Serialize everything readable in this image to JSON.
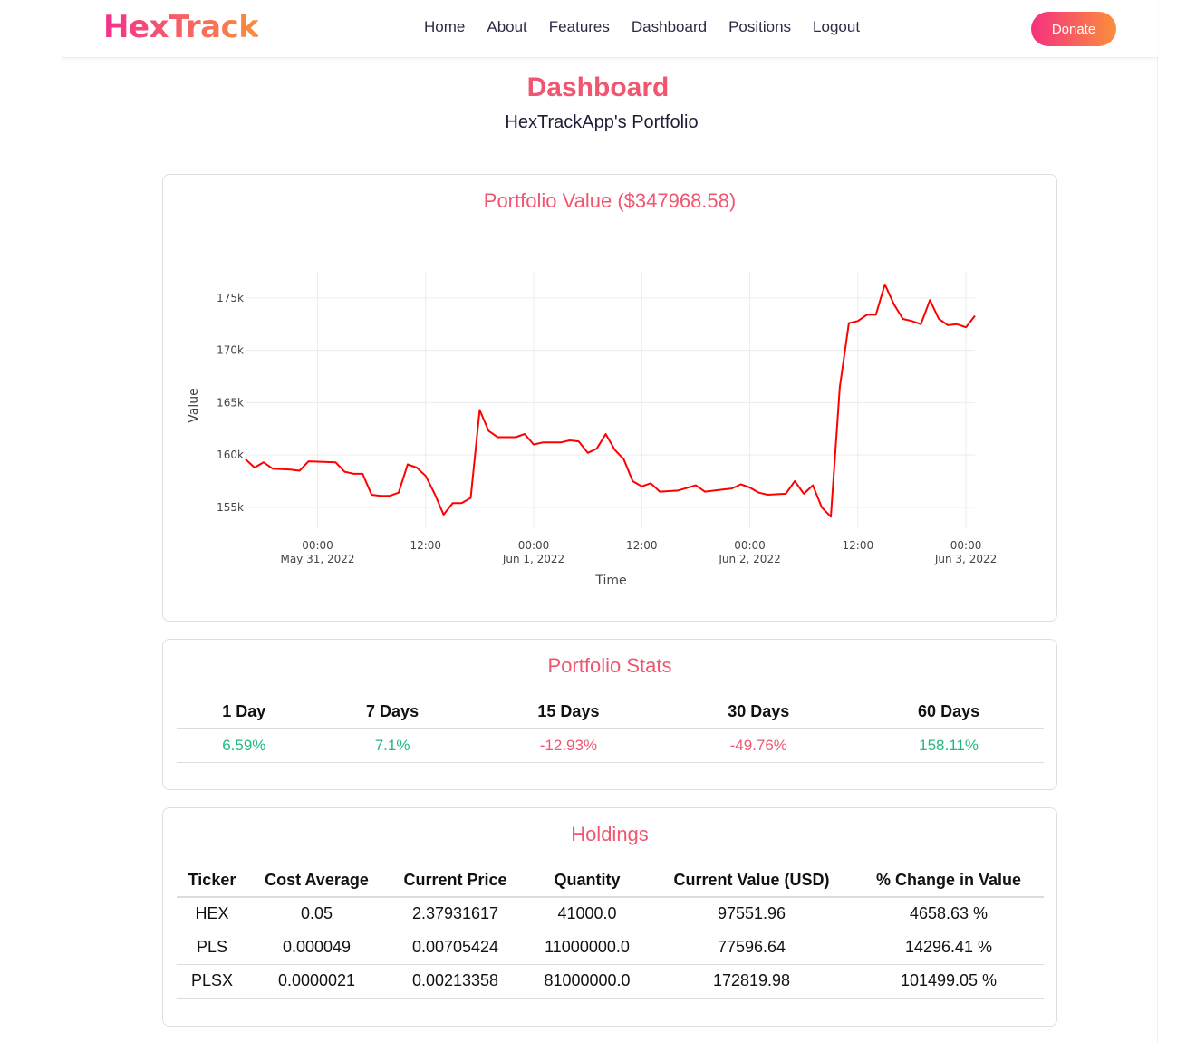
{
  "brand": {
    "name": "HexTrack"
  },
  "nav": {
    "items": [
      "Home",
      "About",
      "Features",
      "Dashboard",
      "Positions",
      "Logout"
    ],
    "donate_label": "Donate"
  },
  "header": {
    "title": "Dashboard",
    "subtitle": "HexTrackApp's Portfolio"
  },
  "chart": {
    "title": "Portfolio Value ($347968.58)"
  },
  "chart_data": {
    "type": "line",
    "xlabel": "Time",
    "ylabel": "Value",
    "line_color": "#ff0000",
    "grid": true,
    "ylim": [
      153000,
      177500
    ],
    "xlim": [
      "2022-05-30 16:00",
      "2022-06-03 01:00"
    ],
    "yticks": [
      {
        "value": 155000,
        "label": "155k"
      },
      {
        "value": 160000,
        "label": "160k"
      },
      {
        "value": 165000,
        "label": "165k"
      },
      {
        "value": 170000,
        "label": "170k"
      },
      {
        "value": 175000,
        "label": "175k"
      }
    ],
    "xticks": [
      {
        "value": "2022-05-31 00:00",
        "label": "00:00",
        "sublabel": "May 31, 2022"
      },
      {
        "value": "2022-05-31 12:00",
        "label": "12:00",
        "sublabel": ""
      },
      {
        "value": "2022-06-01 00:00",
        "label": "00:00",
        "sublabel": "Jun 1, 2022"
      },
      {
        "value": "2022-06-01 12:00",
        "label": "12:00",
        "sublabel": ""
      },
      {
        "value": "2022-06-02 00:00",
        "label": "00:00",
        "sublabel": "Jun 2, 2022"
      },
      {
        "value": "2022-06-02 12:00",
        "label": "12:00",
        "sublabel": ""
      },
      {
        "value": "2022-06-03 00:00",
        "label": "00:00",
        "sublabel": "Jun 3, 2022"
      }
    ],
    "series": [
      {
        "points": [
          [
            "2022-05-30 16:00",
            159600
          ],
          [
            "2022-05-30 17:00",
            158800
          ],
          [
            "2022-05-30 18:00",
            159300
          ],
          [
            "2022-05-30 19:00",
            158700
          ],
          [
            "2022-05-30 21:00",
            158600
          ],
          [
            "2022-05-30 22:00",
            158500
          ],
          [
            "2022-05-30 23:00",
            159400
          ],
          [
            "2022-05-31 02:00",
            159300
          ],
          [
            "2022-05-31 03:00",
            158400
          ],
          [
            "2022-05-31 04:00",
            158200
          ],
          [
            "2022-05-31 05:00",
            158200
          ],
          [
            "2022-05-31 06:00",
            156200
          ],
          [
            "2022-05-31 07:00",
            156100
          ],
          [
            "2022-05-31 08:00",
            156100
          ],
          [
            "2022-05-31 09:00",
            156400
          ],
          [
            "2022-05-31 10:00",
            159100
          ],
          [
            "2022-05-31 11:00",
            158800
          ],
          [
            "2022-05-31 12:00",
            158000
          ],
          [
            "2022-05-31 13:00",
            156300
          ],
          [
            "2022-05-31 14:00",
            154300
          ],
          [
            "2022-05-31 15:00",
            155400
          ],
          [
            "2022-05-31 16:00",
            155400
          ],
          [
            "2022-05-31 17:00",
            155900
          ],
          [
            "2022-05-31 18:00",
            164300
          ],
          [
            "2022-05-31 19:00",
            162300
          ],
          [
            "2022-05-31 20:00",
            161700
          ],
          [
            "2022-05-31 22:00",
            161700
          ],
          [
            "2022-05-31 23:00",
            162000
          ],
          [
            "2022-06-01 00:00",
            161000
          ],
          [
            "2022-06-01 01:00",
            161200
          ],
          [
            "2022-06-01 03:00",
            161200
          ],
          [
            "2022-06-01 04:00",
            161400
          ],
          [
            "2022-06-01 05:00",
            161300
          ],
          [
            "2022-06-01 06:00",
            160200
          ],
          [
            "2022-06-01 07:00",
            160600
          ],
          [
            "2022-06-01 08:00",
            162000
          ],
          [
            "2022-06-01 09:00",
            160500
          ],
          [
            "2022-06-01 10:00",
            159600
          ],
          [
            "2022-06-01 11:00",
            157500
          ],
          [
            "2022-06-01 12:00",
            157000
          ],
          [
            "2022-06-01 13:00",
            157300
          ],
          [
            "2022-06-01 14:00",
            156500
          ],
          [
            "2022-06-01 16:00",
            156600
          ],
          [
            "2022-06-01 18:00",
            157100
          ],
          [
            "2022-06-01 19:00",
            156500
          ],
          [
            "2022-06-01 21:00",
            156700
          ],
          [
            "2022-06-01 22:00",
            156800
          ],
          [
            "2022-06-01 23:00",
            157200
          ],
          [
            "2022-06-02 00:00",
            156900
          ],
          [
            "2022-06-02 01:00",
            156400
          ],
          [
            "2022-06-02 02:00",
            156200
          ],
          [
            "2022-06-02 04:00",
            156300
          ],
          [
            "2022-06-02 05:00",
            157500
          ],
          [
            "2022-06-02 06:00",
            156300
          ],
          [
            "2022-06-02 07:00",
            157100
          ],
          [
            "2022-06-02 08:00",
            155000
          ],
          [
            "2022-06-02 09:00",
            154100
          ],
          [
            "2022-06-02 10:00",
            166500
          ],
          [
            "2022-06-02 11:00",
            172600
          ],
          [
            "2022-06-02 12:00",
            172800
          ],
          [
            "2022-06-02 13:00",
            173400
          ],
          [
            "2022-06-02 14:00",
            173400
          ],
          [
            "2022-06-02 15:00",
            176300
          ],
          [
            "2022-06-02 16:00",
            174400
          ],
          [
            "2022-06-02 17:00",
            173000
          ],
          [
            "2022-06-02 18:00",
            172800
          ],
          [
            "2022-06-02 19:00",
            172500
          ],
          [
            "2022-06-02 20:00",
            174800
          ],
          [
            "2022-06-02 21:00",
            173000
          ],
          [
            "2022-06-02 22:00",
            172400
          ],
          [
            "2022-06-02 23:00",
            172500
          ],
          [
            "2022-06-03 00:00",
            172200
          ],
          [
            "2022-06-03 01:00",
            173300
          ]
        ]
      }
    ]
  },
  "stats": {
    "title": "Portfolio Stats",
    "columns": [
      "1 Day",
      "7 Days",
      "15 Days",
      "30 Days",
      "60 Days"
    ],
    "values": [
      "6.59%",
      "7.1%",
      "-12.93%",
      "-49.76%",
      "158.11%"
    ]
  },
  "holdings": {
    "title": "Holdings",
    "columns": [
      "Ticker",
      "Cost Average",
      "Current Price",
      "Quantity",
      "Current Value (USD)",
      "% Change in Value"
    ],
    "rows": [
      [
        "HEX",
        "0.05",
        "2.37931617",
        "41000.0",
        "97551.96",
        "4658.63 %"
      ],
      [
        "PLS",
        "0.000049",
        "0.00705424",
        "11000000.0",
        "77596.64",
        "14296.41 %"
      ],
      [
        "PLSX",
        "0.0000021",
        "0.00213358",
        "81000000.0",
        "172819.98",
        "101499.05 %"
      ]
    ]
  },
  "colors": {
    "accent": "#f0566f",
    "positive": "#22b97f",
    "negative": "#f0566f",
    "brand_gradient_start": "#f52f8c",
    "brand_gradient_end": "#f98d3d"
  }
}
